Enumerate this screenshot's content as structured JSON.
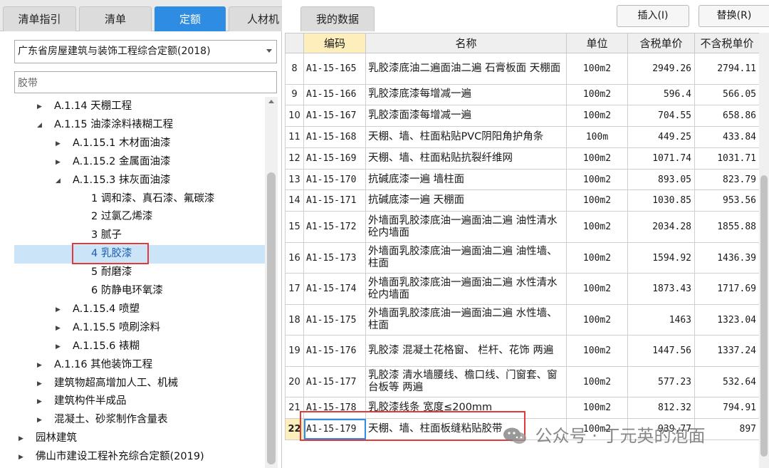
{
  "tabs": [
    {
      "label": "清单指引",
      "active": false
    },
    {
      "label": "清单",
      "active": false
    },
    {
      "label": "定额",
      "active": true
    },
    {
      "label": "人材机",
      "active": false
    },
    {
      "label": "我的数据",
      "active": false
    }
  ],
  "quota_library": {
    "selected": "广东省房屋建筑与装饰工程综合定额(2018)"
  },
  "search": {
    "value": "胶带"
  },
  "toolbar": {
    "insert_label": "插入(I)",
    "replace_label": "替换(R)"
  },
  "tree": [
    {
      "label": "A.1.14 天棚工程",
      "toggle": "expand"
    },
    {
      "label": "A.1.15 油漆涂料裱糊工程",
      "toggle": "collapse"
    },
    {
      "label": "A.1.15.1 木材面油漆",
      "toggle": "expand"
    },
    {
      "label": "A.1.15.2 金属面油漆",
      "toggle": "expand"
    },
    {
      "label": "A.1.15.3 抹灰面油漆",
      "toggle": "collapse"
    },
    {
      "label": "1 调和漆、真石漆、氟碳漆",
      "toggle": "none"
    },
    {
      "label": "2 过氯乙烯漆",
      "toggle": "none"
    },
    {
      "label": "3 腻子",
      "toggle": "none"
    },
    {
      "label": "4 乳胶漆",
      "toggle": "none",
      "selected": true
    },
    {
      "label": "5 耐磨漆",
      "toggle": "none"
    },
    {
      "label": "6 防静电环氧漆",
      "toggle": "none"
    },
    {
      "label": "A.1.15.4 喷塑",
      "toggle": "expand"
    },
    {
      "label": "A.1.15.5 喷刷涂料",
      "toggle": "expand"
    },
    {
      "label": "A.1.15.6 裱糊",
      "toggle": "expand"
    },
    {
      "label": "A.1.16 其他装饰工程",
      "toggle": "expand"
    },
    {
      "label": "建筑物超高增加人工、机械",
      "toggle": "expand"
    },
    {
      "label": "建筑构件半成品",
      "toggle": "expand"
    },
    {
      "label": "混凝土、砂浆制作含量表",
      "toggle": "expand"
    },
    {
      "label": "园林建筑",
      "toggle": "expand"
    },
    {
      "label": "佛山市建设工程补充综合定额(2019)",
      "toggle": "expand"
    }
  ],
  "table": {
    "headers": {
      "code": "编码",
      "name": "名称",
      "unit": "单位",
      "tax_price": "含税单价",
      "notax_price": "不含税单价"
    },
    "rows": [
      {
        "no": "8",
        "code": "A1-15-165",
        "name": "乳胶漆底油二遍面油二遍 石膏板面 天棚面",
        "unit": "100m2",
        "tax_price": "2949.26",
        "notax_price": "2794.11"
      },
      {
        "no": "9",
        "code": "A1-15-166",
        "name": "乳胶漆底漆每增减一遍",
        "unit": "100m2",
        "tax_price": "596.4",
        "notax_price": "566.05"
      },
      {
        "no": "10",
        "code": "A1-15-167",
        "name": "乳胶漆面漆每增减一遍",
        "unit": "100m2",
        "tax_price": "704.55",
        "notax_price": "658.86"
      },
      {
        "no": "11",
        "code": "A1-15-168",
        "name": "天棚、墙、柱面粘贴PVC阴阳角护角条",
        "unit": "100m",
        "tax_price": "449.25",
        "notax_price": "433.84"
      },
      {
        "no": "12",
        "code": "A1-15-169",
        "name": "天棚、墙、柱面粘贴抗裂纤维网",
        "unit": "100m2",
        "tax_price": "1071.74",
        "notax_price": "1031.71"
      },
      {
        "no": "13",
        "code": "A1-15-170",
        "name": "抗碱底漆一遍 墙柱面",
        "unit": "100m2",
        "tax_price": "893.05",
        "notax_price": "823.79"
      },
      {
        "no": "14",
        "code": "A1-15-171",
        "name": "抗碱底漆一遍 天棚面",
        "unit": "100m2",
        "tax_price": "1030.85",
        "notax_price": "953.56"
      },
      {
        "no": "15",
        "code": "A1-15-172",
        "name": "外墙面乳胶漆底油一遍面油二遍 油性清水砼内墙面",
        "unit": "100m2",
        "tax_price": "2034.28",
        "notax_price": "1855.88"
      },
      {
        "no": "16",
        "code": "A1-15-173",
        "name": "外墙面乳胶漆底油一遍面油二遍 油性墙、柱面",
        "unit": "100m2",
        "tax_price": "1594.92",
        "notax_price": "1436.39"
      },
      {
        "no": "17",
        "code": "A1-15-174",
        "name": "外墙面乳胶漆底油一遍面油二遍 水性清水砼内墙面",
        "unit": "100m2",
        "tax_price": "1873.43",
        "notax_price": "1717.69"
      },
      {
        "no": "18",
        "code": "A1-15-175",
        "name": "外墙面乳胶漆底油一遍面油二遍 水性墙、柱面",
        "unit": "100m2",
        "tax_price": "1463",
        "notax_price": "1323.04"
      },
      {
        "no": "19",
        "code": "A1-15-176",
        "name": "乳胶漆 混凝土花格窗、 栏杆、花饰 两遍",
        "unit": "100m2",
        "tax_price": "1447.56",
        "notax_price": "1337.24"
      },
      {
        "no": "20",
        "code": "A1-15-177",
        "name": "乳胶漆 清水墙腰线、檐口线、门窗套、窗台板等 两遍",
        "unit": "100m2",
        "tax_price": "577.23",
        "notax_price": "532.64"
      },
      {
        "no": "21",
        "code": "A1-15-178",
        "name": "乳胶漆线条 宽度≤200mm",
        "unit": "100m2",
        "tax_price": "812.32",
        "notax_price": "794.91"
      },
      {
        "no": "22",
        "code": "A1-15-179",
        "name": "天棚、墙、柱面板缝粘贴胶带",
        "unit": "100m2",
        "tax_price": "939.77",
        "notax_price": "897",
        "current": true
      }
    ]
  },
  "watermark": {
    "text": "公众号 · 丁元英的泡面",
    "icon": "wechat-icon"
  }
}
